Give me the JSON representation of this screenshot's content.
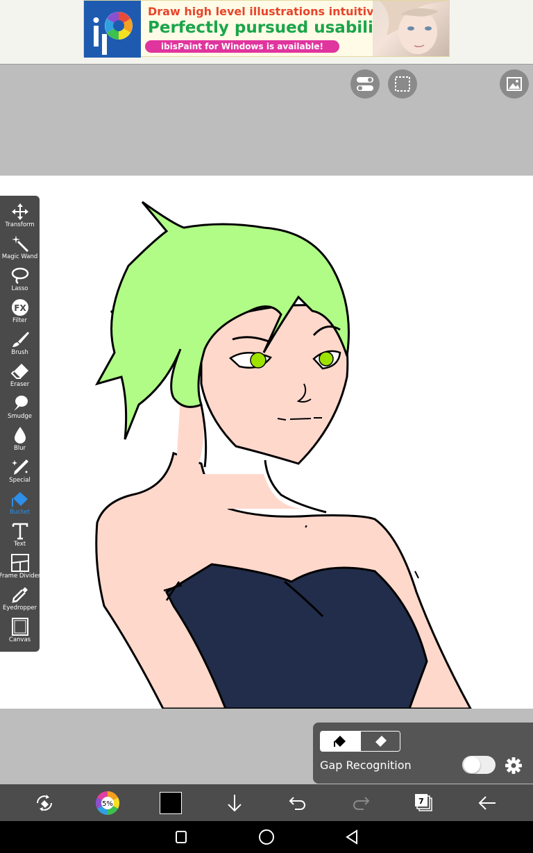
{
  "ad": {
    "line1_part1": "Draw",
    "line1_part2": " high level illustrations intuitively!",
    "line2": "Perfectly pursued usability!",
    "line3": "ibisPaint for Windows is available!"
  },
  "top_buttons": [
    {
      "icon": "toggle-settings-icon"
    },
    {
      "icon": "selection-icon"
    },
    {
      "icon": "reference-image-icon"
    }
  ],
  "tools": [
    {
      "label": "Transform",
      "icon": "move-arrows-icon"
    },
    {
      "label": "Magic Wand",
      "icon": "magic-wand-icon"
    },
    {
      "label": "Lasso",
      "icon": "lasso-icon"
    },
    {
      "label": "Filter",
      "icon": "fx-icon"
    },
    {
      "label": "Brush",
      "icon": "brush-icon"
    },
    {
      "label": "Eraser",
      "icon": "eraser-icon"
    },
    {
      "label": "Smudge",
      "icon": "smudge-icon"
    },
    {
      "label": "Blur",
      "icon": "blur-drop-icon"
    },
    {
      "label": "Special",
      "icon": "special-pen-icon"
    },
    {
      "label": "Bucket",
      "icon": "bucket-icon"
    },
    {
      "label": "Text",
      "icon": "text-icon"
    },
    {
      "label": "Frame Divider",
      "icon": "frame-divider-icon"
    },
    {
      "label": "Eyedropper",
      "icon": "eyedropper-icon"
    },
    {
      "label": "Canvas",
      "icon": "canvas-icon"
    }
  ],
  "active_tool": "Bucket",
  "fill_panel": {
    "gap_label": "Gap Recognition",
    "gap_enabled": false
  },
  "bottom_bar": {
    "color_wheel_value": "5%",
    "current_color": "#000000",
    "layer_count": "7"
  },
  "colors": {
    "accent": "#2e8fe8",
    "hair": "#b0fc87",
    "skin": "#ffd8cc",
    "dress": "#212d4a",
    "eyes": "#9ee200"
  }
}
